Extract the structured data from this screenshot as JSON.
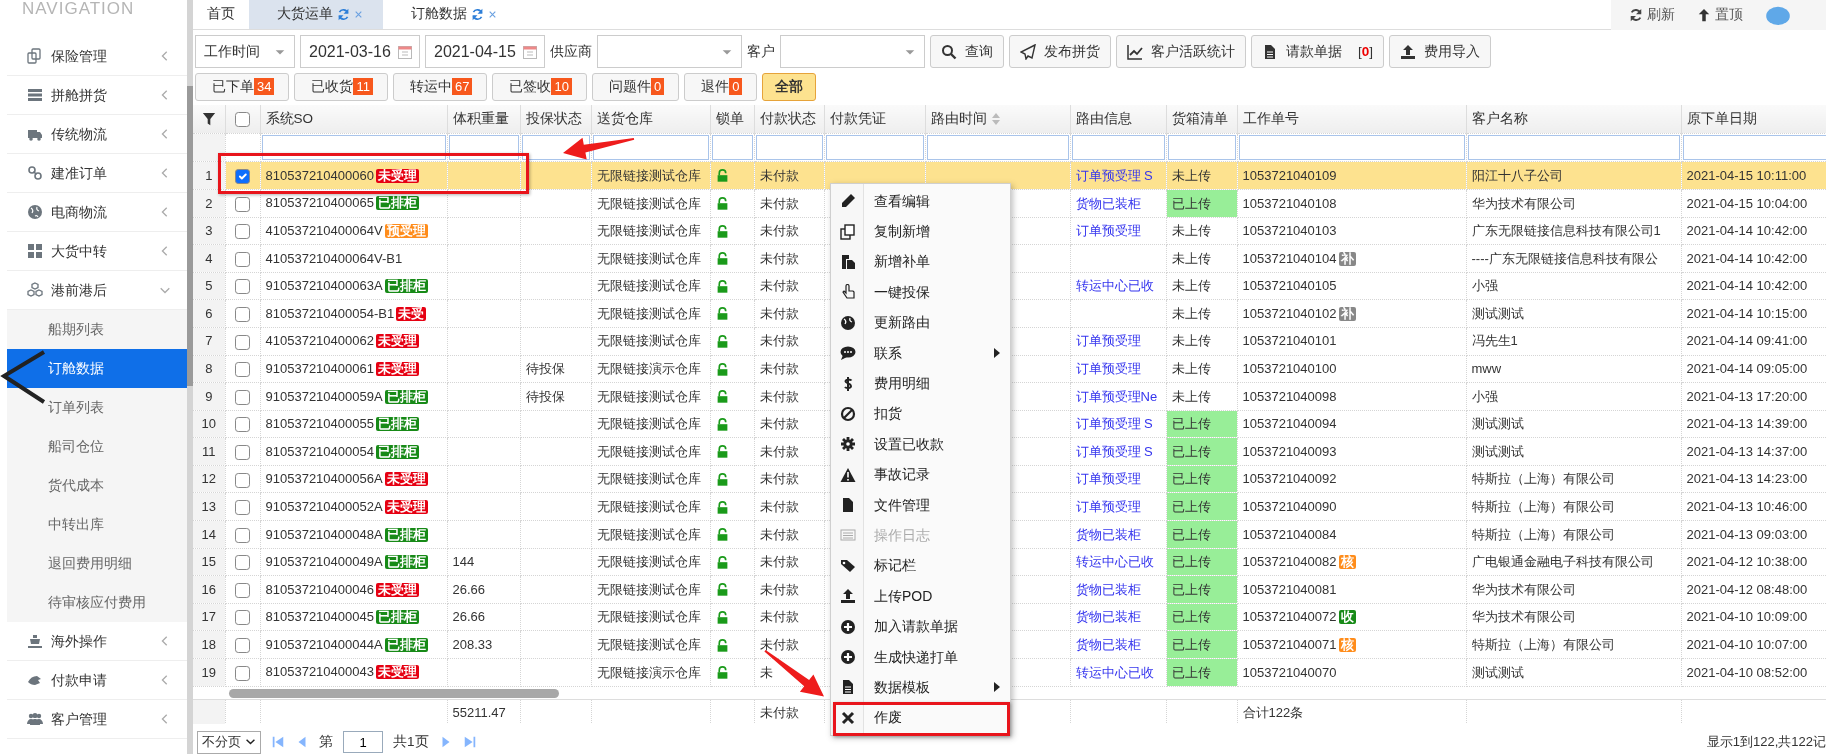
{
  "nav": {
    "title": "NAVIGATION",
    "items": [
      {
        "label": "保险管理",
        "expanded": false
      },
      {
        "label": "拼舱拼货",
        "expanded": false
      },
      {
        "label": "传统物流",
        "expanded": false
      },
      {
        "label": "建准订单",
        "expanded": false
      },
      {
        "label": "电商物流",
        "expanded": false
      },
      {
        "label": "大货中转",
        "expanded": false
      },
      {
        "label": "港前港后",
        "expanded": true,
        "children": [
          {
            "label": "船期列表",
            "selected": false
          },
          {
            "label": "订舱数据",
            "selected": true
          },
          {
            "label": "订单列表",
            "selected": false
          },
          {
            "label": "船司仓位",
            "selected": false
          },
          {
            "label": "货代成本",
            "selected": false
          },
          {
            "label": "中转出库",
            "selected": false
          },
          {
            "label": "退回费用明细",
            "selected": false
          },
          {
            "label": "待审核应付费用",
            "selected": false
          }
        ]
      },
      {
        "label": "海外操作",
        "expanded": false
      },
      {
        "label": "付款申请",
        "expanded": false
      },
      {
        "label": "客户管理",
        "expanded": false
      }
    ]
  },
  "tabs": [
    {
      "label": "首页",
      "selected": false,
      "closable": false
    },
    {
      "label": "大货运单",
      "selected": true,
      "closable": true
    },
    {
      "label": "订舱数据",
      "selected": false,
      "closable": true
    }
  ],
  "top_actions": [
    {
      "label": "刷新"
    },
    {
      "label": "置顶"
    }
  ],
  "filters": {
    "date_field": "工作时间",
    "date_from": "2021-03-16",
    "date_to": "2021-04-15",
    "supplier_label": "供应商",
    "customer_label": "客户"
  },
  "buttons": [
    {
      "label": "查询"
    },
    {
      "label": "发布拼货"
    },
    {
      "label": "客户活跃统计"
    },
    {
      "label": "请款单据",
      "count_open": "[",
      "count": "0",
      "count_close": "]"
    },
    {
      "label": "费用导入"
    }
  ],
  "status_buttons": [
    {
      "label": "已下单",
      "count": "34",
      "selected": false
    },
    {
      "label": "已收货",
      "count": "11",
      "selected": false
    },
    {
      "label": "转运中",
      "count": "67",
      "selected": false
    },
    {
      "label": "已签收",
      "count": "10",
      "selected": false
    },
    {
      "label": "问题件",
      "count": "0",
      "selected": false
    },
    {
      "label": "退件",
      "count": "0",
      "selected": false
    },
    {
      "label": "全部",
      "selected": true
    }
  ],
  "table": {
    "header_checked": false,
    "columns": [
      {
        "label": "系统SO",
        "sortable": false
      },
      {
        "label": "体积重量",
        "sortable": false
      },
      {
        "label": "投保状态",
        "sortable": false
      },
      {
        "label": "送货仓库",
        "sortable": false
      },
      {
        "label": "锁单",
        "sortable": false
      },
      {
        "label": "付款状态",
        "sortable": false
      },
      {
        "label": "付款凭证",
        "sortable": false
      },
      {
        "label": "路由时间",
        "sortable": true
      },
      {
        "label": "路由信息",
        "sortable": false
      },
      {
        "label": "货箱清单",
        "sortable": false
      },
      {
        "label": "工作单号",
        "sortable": false
      },
      {
        "label": "客户名称",
        "sortable": false
      },
      {
        "label": "原下单日期",
        "sortable": false
      }
    ],
    "rows": [
      {
        "row_number": "1",
        "checked": true,
        "selected": true,
        "annotated": true,
        "so": "810537210400060",
        "tag": {
          "text": "未受理",
          "color": "#e60012"
        },
        "warehouse": "无限链接测试仓库",
        "locked": false,
        "pay": "未付款",
        "route": "订单预受理 S",
        "box": "未上传",
        "uploaded": false,
        "work": "1053721040109",
        "customer": "阳江十八子公司",
        "date": "2021-04-15 10:11:00"
      },
      {
        "row_number": "2",
        "checked": false,
        "selected": false,
        "annotated": false,
        "so": "810537210400065",
        "tag": {
          "text": "已排柜",
          "color": "#178a17"
        },
        "warehouse": "无限链接测试仓库",
        "locked": false,
        "pay": "未付款",
        "route": "货物已装柜",
        "box": "已上传",
        "uploaded": true,
        "work": "1053721040108",
        "customer": "华为技术有限公司",
        "date": "2021-04-15 10:04:00"
      },
      {
        "row_number": "3",
        "checked": false,
        "selected": false,
        "annotated": false,
        "so": "410537210400064V",
        "tag": {
          "text": "预受理",
          "color": "#ff8c1a"
        },
        "warehouse": "无限链接测试仓库",
        "locked": false,
        "pay": "未付款",
        "route": "订单预受理",
        "box": "未上传",
        "uploaded": false,
        "work": "1053721040103",
        "customer": "广东无限链接信息科技有限公司1",
        "date": "2021-04-14 10:42:00"
      },
      {
        "row_number": "4",
        "checked": false,
        "selected": false,
        "annotated": false,
        "so": "410537210400064V-B1",
        "warehouse": "无限链接测试仓库",
        "locked": false,
        "pay": "未付款",
        "box": "未上传",
        "uploaded": false,
        "work": "1053721040104",
        "work_tag": {
          "text": "补",
          "color": "#888888"
        },
        "customer": "----广东无限链接信息科技有限公",
        "date": "2021-04-14 10:42:00"
      },
      {
        "row_number": "5",
        "checked": false,
        "selected": false,
        "annotated": false,
        "so": "910537210400063A",
        "tag": {
          "text": "已排柜",
          "color": "#178a17"
        },
        "warehouse": "无限链接测试仓库",
        "locked": false,
        "pay": "未付款",
        "route": "转运中心已收",
        "box": "未上传",
        "uploaded": false,
        "work": "1053721040105",
        "customer": "小强",
        "date": "2021-04-14 10:42:00"
      },
      {
        "row_number": "6",
        "checked": false,
        "selected": false,
        "annotated": false,
        "so": "810537210400054-B1",
        "tag": {
          "text": "未受",
          "color": "#e60012"
        },
        "warehouse": "无限链接测试仓库",
        "locked": false,
        "pay": "未付款",
        "box": "未上传",
        "uploaded": false,
        "work": "1053721040102",
        "work_tag": {
          "text": "补",
          "color": "#888888"
        },
        "customer": "测试测试",
        "date": "2021-04-14 10:15:00"
      },
      {
        "row_number": "7",
        "checked": false,
        "selected": false,
        "annotated": false,
        "so": "410537210400062",
        "tag": {
          "text": "未受理",
          "color": "#e60012"
        },
        "warehouse": "无限链接测试仓库",
        "locked": false,
        "pay": "未付款",
        "route": "订单预受理",
        "box": "未上传",
        "uploaded": false,
        "work": "1053721040101",
        "customer": "冯先生1",
        "date": "2021-04-14 09:41:00"
      },
      {
        "row_number": "8",
        "checked": false,
        "selected": false,
        "annotated": false,
        "so": "910537210400061",
        "tag": {
          "text": "未受理",
          "color": "#e60012"
        },
        "insure": "待投保",
        "warehouse": "无限链接演示仓库",
        "locked": false,
        "pay": "未付款",
        "route": "订单预受理",
        "box": "未上传",
        "uploaded": false,
        "work": "1053721040100",
        "customer": "mww",
        "date": "2021-04-14 09:05:00"
      },
      {
        "row_number": "9",
        "checked": false,
        "selected": false,
        "annotated": false,
        "so": "910537210400059A",
        "tag": {
          "text": "已排柜",
          "color": "#178a17"
        },
        "insure": "待投保",
        "warehouse": "无限链接测试仓库",
        "locked": false,
        "pay": "未付款",
        "route": "订单预受理Ne",
        "box": "未上传",
        "uploaded": false,
        "work": "1053721040098",
        "customer": "小强",
        "date": "2021-04-13 17:20:00"
      },
      {
        "row_number": "10",
        "checked": false,
        "selected": false,
        "annotated": false,
        "so": "810537210400055",
        "tag": {
          "text": "已排柜",
          "color": "#178a17"
        },
        "warehouse": "无限链接测试仓库",
        "locked": false,
        "pay": "未付款",
        "route": "订单预受理 S",
        "box": "已上传",
        "uploaded": true,
        "work": "1053721040094",
        "customer": "测试测试",
        "date": "2021-04-13 14:39:00"
      },
      {
        "row_number": "11",
        "checked": false,
        "selected": false,
        "annotated": false,
        "so": "810537210400054",
        "tag": {
          "text": "已排柜",
          "color": "#178a17"
        },
        "warehouse": "无限链接测试仓库",
        "locked": false,
        "pay": "未付款",
        "route": "订单预受理 S",
        "box": "已上传",
        "uploaded": true,
        "work": "1053721040093",
        "customer": "测试测试",
        "date": "2021-04-13 14:37:00"
      },
      {
        "row_number": "12",
        "checked": false,
        "selected": false,
        "annotated": false,
        "so": "910537210400056A",
        "tag": {
          "text": "未受理",
          "color": "#e60012"
        },
        "warehouse": "无限链接测试仓库",
        "locked": false,
        "pay": "未付款",
        "route": "订单预受理",
        "box": "已上传",
        "uploaded": true,
        "work": "1053721040092",
        "customer": "特斯拉（上海）有限公司",
        "date": "2021-04-13 14:23:00"
      },
      {
        "row_number": "13",
        "checked": false,
        "selected": false,
        "annotated": false,
        "so": "910537210400052A",
        "tag": {
          "text": "未受理",
          "color": "#e60012"
        },
        "warehouse": "无限链接测试仓库",
        "locked": false,
        "pay": "未付款",
        "route": "订单预受理",
        "box": "已上传",
        "uploaded": true,
        "work": "1053721040090",
        "customer": "特斯拉（上海）有限公司",
        "date": "2021-04-13 10:46:00"
      },
      {
        "row_number": "14",
        "checked": false,
        "selected": false,
        "annotated": false,
        "so": "910537210400048A",
        "tag": {
          "text": "已排柜",
          "color": "#178a17"
        },
        "warehouse": "无限链接测试仓库",
        "locked": false,
        "pay": "未付款",
        "route": "货物已装柜",
        "box": "已上传",
        "uploaded": true,
        "work": "1053721040084",
        "customer": "特斯拉（上海）有限公司",
        "date": "2021-04-13 09:03:00"
      },
      {
        "row_number": "15",
        "checked": false,
        "selected": false,
        "annotated": false,
        "so": "910537210400049A",
        "tag": {
          "text": "已排柜",
          "color": "#178a17"
        },
        "weight": "144",
        "warehouse": "无限链接测试仓库",
        "locked": false,
        "pay": "未付款",
        "route": "转运中心已收",
        "box": "已上传",
        "uploaded": true,
        "work": "1053721040082",
        "work_tag": {
          "text": "核",
          "color": "#ff8c1a"
        },
        "customer": "广电银通金融电子科技有限公司",
        "date": "2021-04-12 10:38:00"
      },
      {
        "row_number": "16",
        "checked": false,
        "selected": false,
        "annotated": false,
        "so": "810537210400046",
        "tag": {
          "text": "未受理",
          "color": "#e60012"
        },
        "weight": "26.66",
        "warehouse": "无限链接测试仓库",
        "locked": false,
        "pay": "未付款",
        "route": "货物已装柜",
        "box": "已上传",
        "uploaded": true,
        "work": "1053721040081",
        "customer": "华为技术有限公司",
        "date": "2021-04-12 08:48:00"
      },
      {
        "row_number": "17",
        "checked": false,
        "selected": false,
        "annotated": false,
        "so": "810537210400045",
        "tag": {
          "text": "已排柜",
          "color": "#178a17"
        },
        "weight": "26.66",
        "warehouse": "无限链接测试仓库",
        "locked": false,
        "pay": "未付款",
        "route": "货物已装柜",
        "box": "已上传",
        "uploaded": true,
        "work": "1053721040072",
        "work_tag": {
          "text": "收",
          "color": "#178a17"
        },
        "customer": "华为技术有限公司",
        "date": "2021-04-10 10:09:00"
      },
      {
        "row_number": "18",
        "checked": false,
        "selected": false,
        "annotated": false,
        "so": "910537210400044A",
        "tag": {
          "text": "已排柜",
          "color": "#178a17"
        },
        "weight": "208.33",
        "warehouse": "无限链接测试仓库",
        "locked": false,
        "pay": "未付款",
        "route": "货物已装柜",
        "box": "已上传",
        "uploaded": true,
        "work": "1053721040071",
        "work_tag": {
          "text": "核",
          "color": "#ff8c1a"
        },
        "customer": "特斯拉（上海）有限公司",
        "date": "2021-04-10 10:07:00"
      },
      {
        "row_number": "19",
        "checked": false,
        "selected": false,
        "annotated": false,
        "so": "810537210400043",
        "tag": {
          "text": "未受理",
          "color": "#e60012"
        },
        "warehouse": "无限链接演示仓库",
        "locked": false,
        "pay": "未",
        "route": "转运中心已收",
        "box": "已上传",
        "uploaded": true,
        "work": "1053721040070",
        "customer": "测试测试",
        "date": "2021-04-10 08:52:00"
      }
    ],
    "totals": {
      "weight": "55211.47",
      "pay": "未付款",
      "work": "合计122条"
    }
  },
  "pager": {
    "page_size": "不分页",
    "page_label": "第",
    "page": "1",
    "pages": "共1页",
    "summary": "显示1到122,共122记"
  },
  "context_menu": [
    {
      "label": "查看编辑",
      "disabled": false,
      "submenu": false,
      "annotated": false
    },
    {
      "label": "复制新增",
      "disabled": false,
      "submenu": false,
      "annotated": false
    },
    {
      "label": "新增补单",
      "disabled": false,
      "submenu": false,
      "annotated": false
    },
    {
      "label": "一键投保",
      "disabled": false,
      "submenu": false,
      "annotated": false
    },
    {
      "label": "更新路由",
      "disabled": false,
      "submenu": false,
      "annotated": false
    },
    {
      "label": "联系",
      "disabled": false,
      "submenu": true,
      "annotated": false
    },
    {
      "label": "费用明细",
      "disabled": false,
      "submenu": false,
      "annotated": false
    },
    {
      "label": "扣货",
      "disabled": false,
      "submenu": false,
      "annotated": false
    },
    {
      "label": "设置已收款",
      "disabled": false,
      "submenu": false,
      "annotated": false
    },
    {
      "label": "事故记录",
      "disabled": false,
      "submenu": false,
      "annotated": false
    },
    {
      "label": "文件管理",
      "disabled": false,
      "submenu": false,
      "annotated": false
    },
    {
      "label": "操作日志",
      "disabled": true,
      "submenu": false,
      "annotated": false
    },
    {
      "label": "标记栏",
      "disabled": false,
      "submenu": false,
      "annotated": false
    },
    {
      "label": "上传POD",
      "disabled": false,
      "submenu": false,
      "annotated": false
    },
    {
      "label": "加入请款单据",
      "disabled": false,
      "submenu": false,
      "annotated": false
    },
    {
      "label": "生成快递打单",
      "disabled": false,
      "submenu": false,
      "annotated": false
    },
    {
      "label": "数据模板",
      "disabled": false,
      "submenu": true,
      "annotated": false
    },
    {
      "label": "作废",
      "disabled": false,
      "submenu": false,
      "annotated": true
    }
  ]
}
